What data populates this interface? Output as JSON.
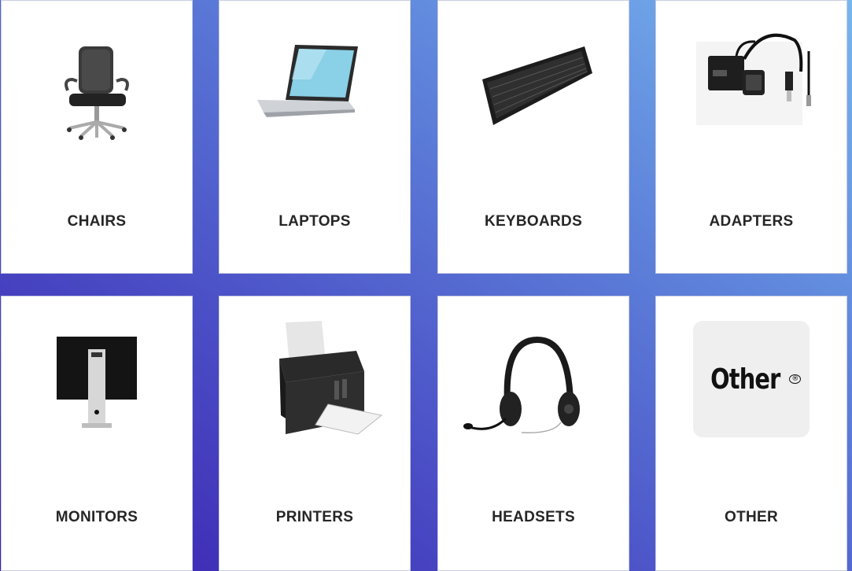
{
  "categories": [
    {
      "label": "CHAIRS",
      "icon": "office-chair-icon"
    },
    {
      "label": "LAPTOPS",
      "icon": "laptop-icon"
    },
    {
      "label": "KEYBOARDS",
      "icon": "keyboard-icon"
    },
    {
      "label": "ADAPTERS",
      "icon": "adapter-icon"
    },
    {
      "label": "MONITORS",
      "icon": "monitor-icon"
    },
    {
      "label": "PRINTERS",
      "icon": "printer-icon"
    },
    {
      "label": "HEADSETS",
      "icon": "headset-icon"
    },
    {
      "label": "OTHER",
      "icon": "other-logo-icon"
    }
  ],
  "other_logo": {
    "text": "Other",
    "mark": "®"
  }
}
